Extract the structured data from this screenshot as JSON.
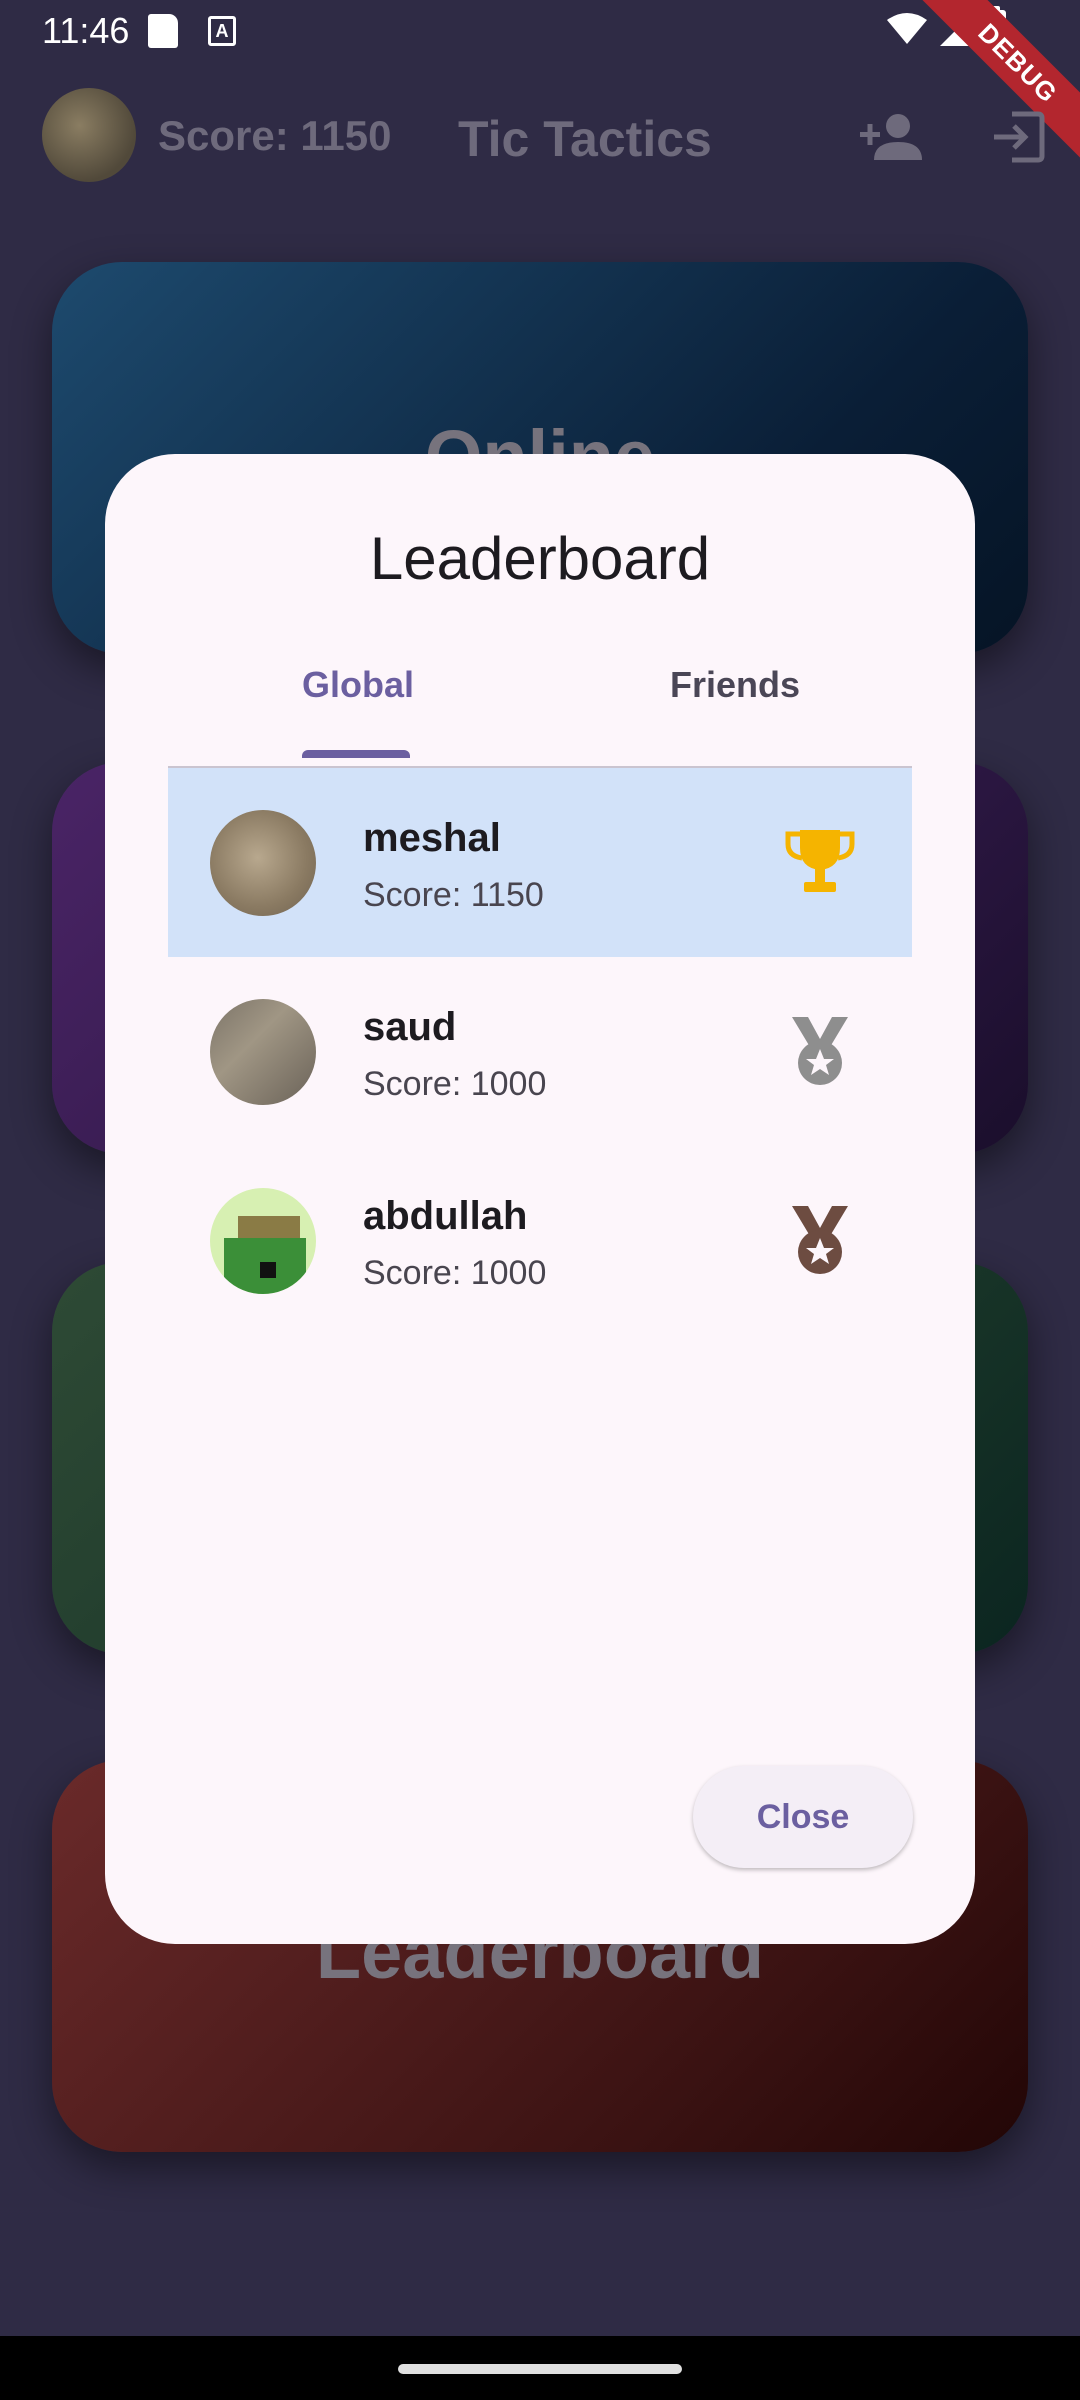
{
  "status_bar": {
    "time": "11:46"
  },
  "debug_banner": "DEBUG",
  "app_bar": {
    "score": "Score: 1150",
    "title": "Tic Tactics"
  },
  "menu_cards": {
    "online": "Online",
    "leaderboard": "Leaderboard"
  },
  "dialog": {
    "title": "Leaderboard",
    "tabs": [
      {
        "label": "Global",
        "selected": true
      },
      {
        "label": "Friends",
        "selected": false
      }
    ],
    "entries": [
      {
        "name": "meshal",
        "score": "Score: 1150",
        "icon": "trophy-icon",
        "highlighted": true
      },
      {
        "name": "saud",
        "score": "Score: 1000",
        "icon": "silver-medal-icon",
        "highlighted": false
      },
      {
        "name": "abdullah",
        "score": "Score: 1000",
        "icon": "bronze-medal-icon",
        "highlighted": false
      }
    ],
    "close_label": "Close"
  },
  "colors": {
    "accent": "#6b5fa0",
    "highlight_row": "#d2e2f9",
    "trophy": "#f5b400",
    "silver": "#8e8e8e",
    "bronze": "#6d4c41"
  }
}
